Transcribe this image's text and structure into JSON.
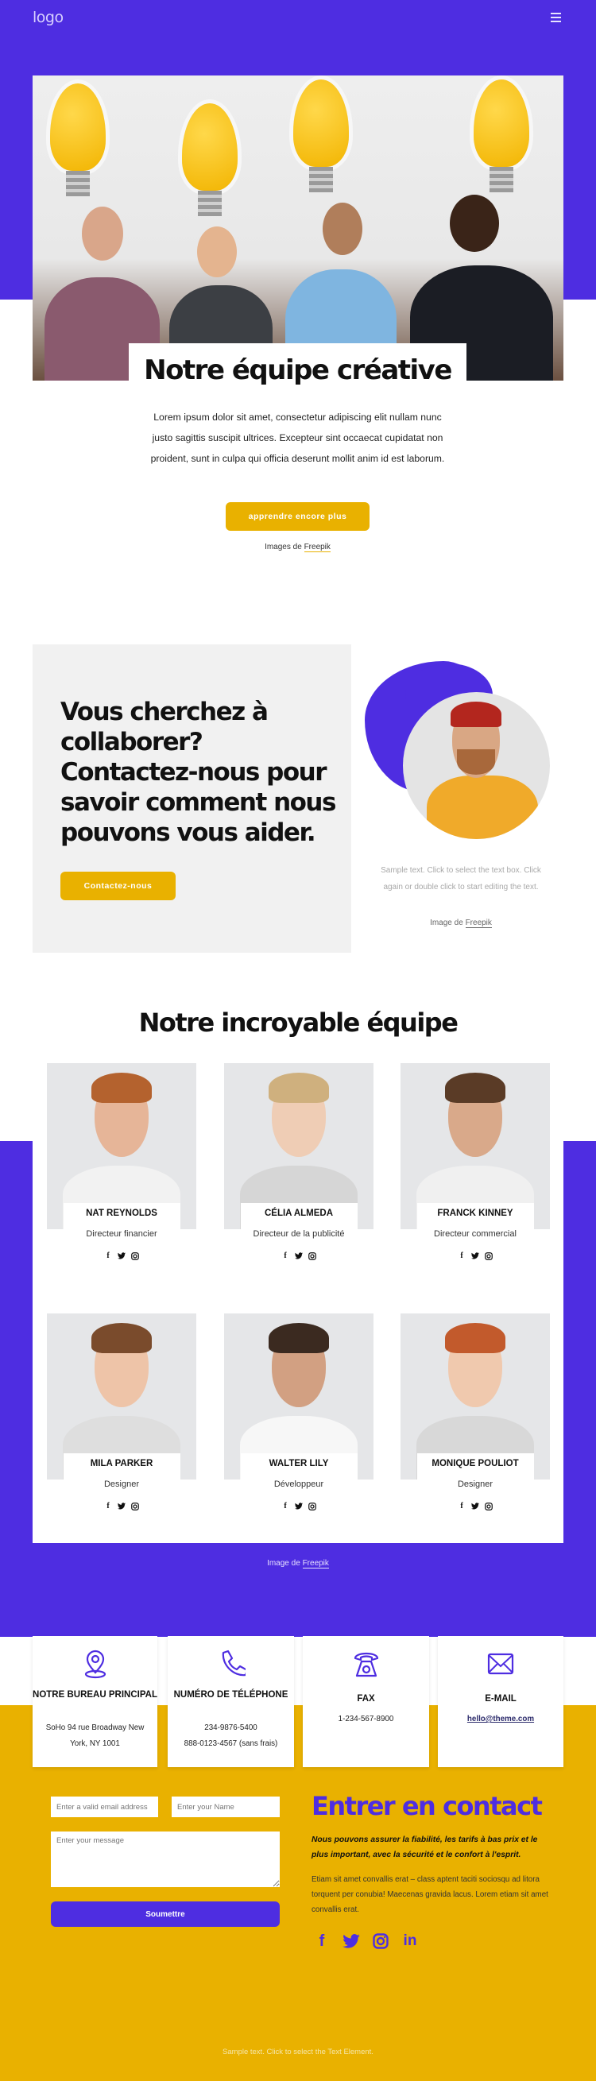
{
  "header": {
    "logo": "logo",
    "menu_icon": "hamburger-menu-icon"
  },
  "hero": {
    "title": "Notre équipe créative",
    "text": "Lorem ipsum dolor sit amet, consectetur adipiscing elit nullam nunc justo sagittis suscipit ultrices. Excepteur sint occaecat cupidatat non proident, sunt in culpa qui officia deserunt mollit anim id est laborum.",
    "button": "apprendre encore plus",
    "credit_prefix": "Images de ",
    "credit_link": "Freepik"
  },
  "collab": {
    "title": "Vous cherchez à collaborer? Contactez-nous pour savoir comment nous pouvons vous aider.",
    "button": "Contactez-nous",
    "sample_text": "Sample text. Click to select the text box. Click again or double click to start editing the text.",
    "credit_prefix": "Image de ",
    "credit_link": "Freepik"
  },
  "team": {
    "title": "Notre incroyable équipe",
    "members": [
      {
        "name": "NAT REYNOLDS",
        "role": "Directeur financier"
      },
      {
        "name": "CÉLIA ALMEDA",
        "role": "Directeur de la publicité"
      },
      {
        "name": "FRANCK KINNEY",
        "role": "Directeur commercial"
      },
      {
        "name": "MILA PARKER",
        "role": "Designer"
      },
      {
        "name": "WALTER LILY",
        "role": "Développeur"
      },
      {
        "name": "MONIQUE POULIOT",
        "role": "Designer"
      }
    ],
    "social": {
      "facebook": "f",
      "twitter": "🐦",
      "instagram": "◎"
    },
    "credit_prefix": "Image de ",
    "credit_link": "Freepik"
  },
  "contact_info": [
    {
      "icon": "location-pin-icon",
      "title": "NOTRE BUREAU PRINCIPAL",
      "lines": [
        "SoHo 94 rue Broadway New York, NY 1001"
      ]
    },
    {
      "icon": "phone-icon",
      "title": "NUMÉRO DE TÉLÉPHONE",
      "lines": [
        "234-9876-5400",
        "888-0123-4567 (sans frais)"
      ]
    },
    {
      "icon": "fax-icon",
      "title": "FAX",
      "lines": [
        "1-234-567-8900"
      ]
    },
    {
      "icon": "email-icon",
      "title": "E-MAIL",
      "lines": [
        "hello@theme.com"
      ]
    }
  ],
  "form": {
    "email_placeholder": "Enter a valid email address",
    "name_placeholder": "Enter your Name",
    "message_placeholder": "Enter your message",
    "submit": "Soumettre"
  },
  "get_in_touch": {
    "title": "Entrer en contact",
    "lead": "Nous pouvons assurer la fiabilité, les tarifs à bas prix et le plus important, avec la sécurité et le confort à l'esprit.",
    "body": "Etiam sit amet convallis erat – class aptent taciti sociosqu ad litora torquent per conubia! Maecenas gravida lacus. Lorem etiam sit amet convallis erat.",
    "social": [
      "facebook",
      "twitter",
      "instagram",
      "linkedin"
    ]
  },
  "footer": {
    "text": "Sample text. Click to select the Text Element."
  },
  "colors": {
    "purple": "#4e2de1",
    "yellow": "#e9b100"
  }
}
